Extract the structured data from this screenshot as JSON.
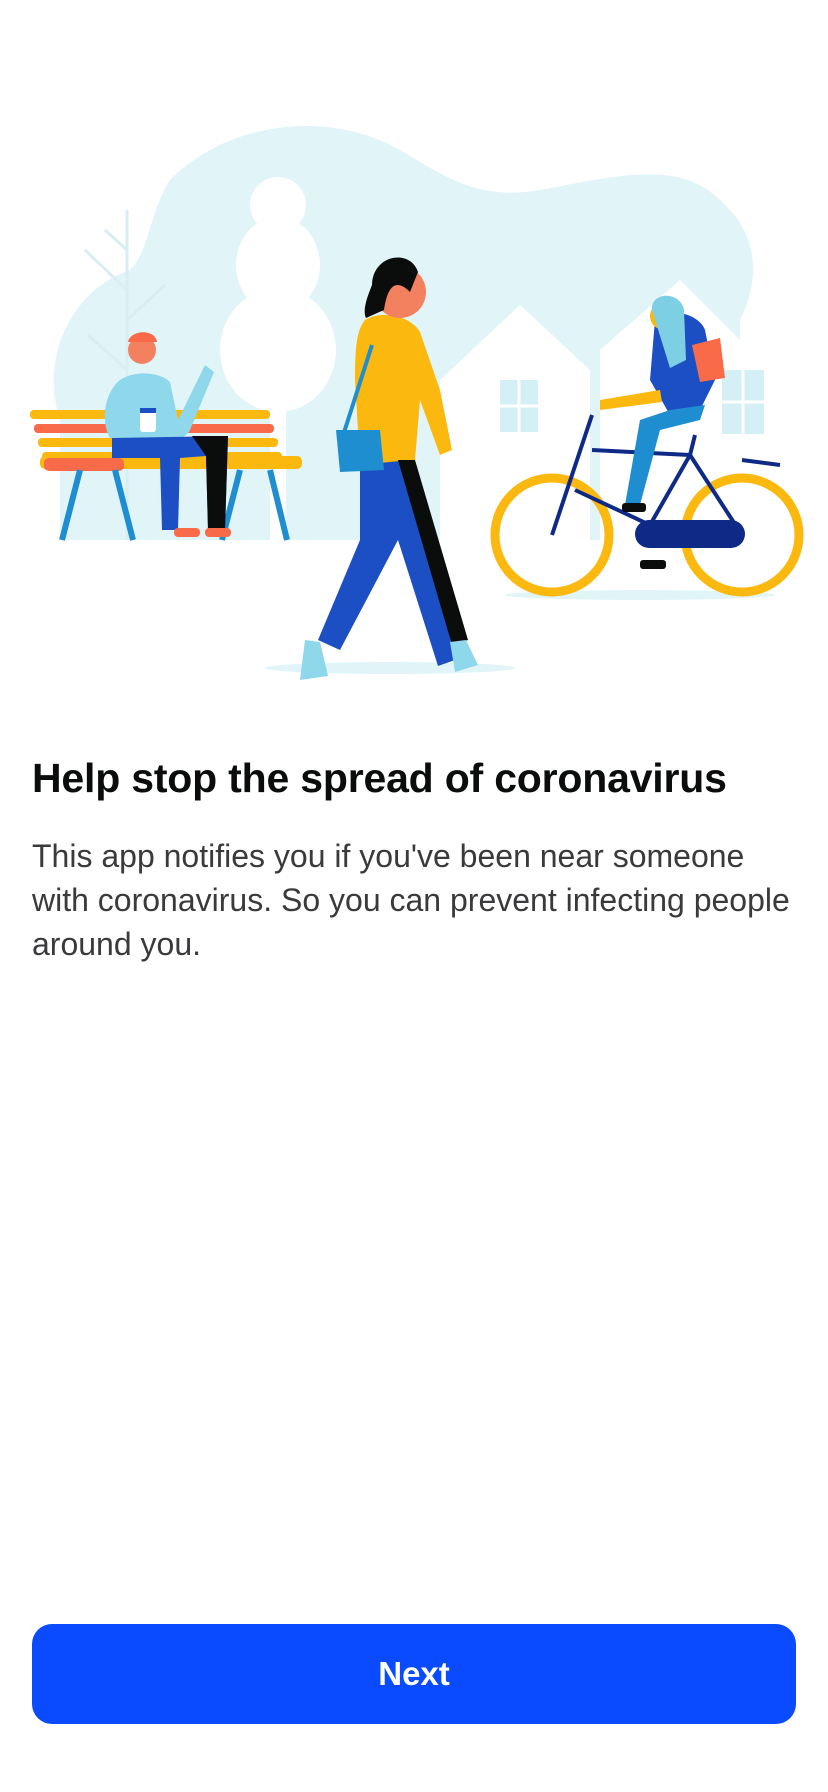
{
  "onboarding": {
    "title": "Help stop the spread of coronavirus",
    "description": "This app notifies you if you've been near someone with coronavirus. So you can prevent infecting people around you.",
    "next_label": "Next"
  },
  "illustration": {
    "name": "people-in-park-illustration",
    "colors": {
      "background_shape": "#e1f5f9",
      "yellow": "#fbb80f",
      "orange": "#f96b48",
      "blue": "#1b4fc3",
      "light_blue": "#7dd0e4",
      "navy": "#0e2a86",
      "skin": "#f38160"
    }
  },
  "colors": {
    "primary_button": "#0a4bff",
    "title_text": "#0b0c0c",
    "body_text": "#3a3a3c"
  }
}
